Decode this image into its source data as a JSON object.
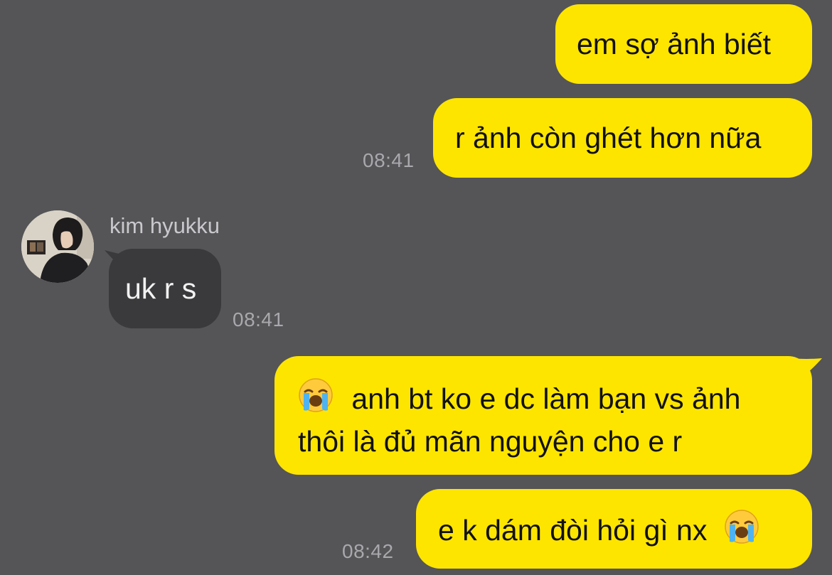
{
  "conversation": {
    "messages": [
      {
        "id": "m1",
        "direction": "out",
        "text": "em sợ ảnh biết"
      },
      {
        "id": "m2",
        "direction": "out",
        "text": "r ảnh còn ghét hơn nữa",
        "time": "08:41"
      },
      {
        "id": "m3",
        "direction": "in",
        "sender": "kim hyukku",
        "text": "uk r s",
        "time": "08:41"
      },
      {
        "id": "m4",
        "direction": "out",
        "emoji": "loudly-crying-face",
        "line1": "anh bt ko e dc làm bạn vs ảnh",
        "line2": "thôi là đủ mãn nguyện cho e r"
      },
      {
        "id": "m5",
        "direction": "out",
        "text": "e k dám đòi hỏi gì nx",
        "emoji": "loudly-crying-face",
        "time": "08:42"
      }
    ]
  },
  "colors": {
    "background": "#555457",
    "outgoing_bubble": "#FEE500",
    "incoming_bubble": "#3a393c"
  }
}
